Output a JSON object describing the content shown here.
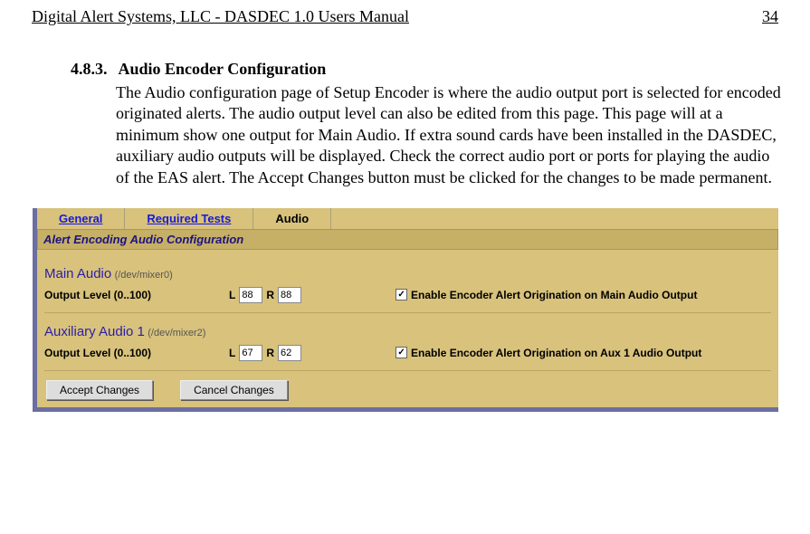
{
  "header": {
    "title": "Digital Alert Systems, LLC - DASDEC 1.0 Users Manual",
    "page_num": "34"
  },
  "section": {
    "number": "4.8.3.",
    "title": "Audio Encoder Configuration",
    "body": "The Audio configuration page of Setup Encoder is where the audio output port is selected for encoded originated alerts. The audio output level can also be edited from this page. This page will at a minimum show one output for Main Audio. If extra sound cards have been installed in the DASDEC, auxiliary audio outputs will be displayed. Check the correct audio port or ports for playing the audio of the EAS alert. The Accept Changes button must be clicked for the changes to be made permanent."
  },
  "ui": {
    "tabs": {
      "general": "General",
      "required": "Required Tests",
      "audio": "Audio"
    },
    "panel_title": "Alert Encoding Audio Configuration",
    "main": {
      "title": "Main Audio",
      "dev": "(/dev/mixer0)",
      "out_label": "Output Level (0..100)",
      "L": "88",
      "R": "88",
      "chk_label": "Enable Encoder Alert Origination on Main Audio Output"
    },
    "aux": {
      "title": "Auxiliary Audio 1",
      "dev": "(/dev/mixer2)",
      "out_label": "Output Level (0..100)",
      "L": "67",
      "R": "62",
      "chk_label": "Enable Encoder Alert Origination on Aux 1 Audio Output"
    },
    "labels": {
      "L": "L",
      "R": "R"
    },
    "buttons": {
      "accept": "Accept Changes",
      "cancel": "Cancel Changes"
    },
    "checkmark": "✓"
  }
}
